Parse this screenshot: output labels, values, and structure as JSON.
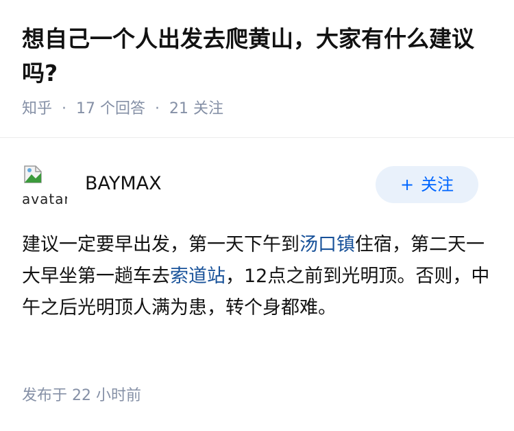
{
  "question": {
    "title": "想自己一个人出发去爬黄山，大家有什么建议吗?",
    "source": "知乎",
    "separator": "·",
    "answers": "17 个回答",
    "followers": "21 关注"
  },
  "author": {
    "avatar_alt": "avatar",
    "name": "BAYMAX",
    "follow_icon": "+",
    "follow_label": "关注"
  },
  "answer": {
    "p1": "建议一定要早出发，第一天下午到",
    "link1": "汤口镇",
    "p2": "住宿，第二天一大早坐第一趟车去",
    "link2": "索道站",
    "p3": "，12点之前到光明顶。否则，中午之后光明顶人满为患，转个身都难。"
  },
  "publish_time": "发布于 22 小时前",
  "colors": {
    "accent": "#0066ff",
    "link": "#175199",
    "meta": "#8590a6",
    "follow_bg": "#e9f1fb"
  }
}
